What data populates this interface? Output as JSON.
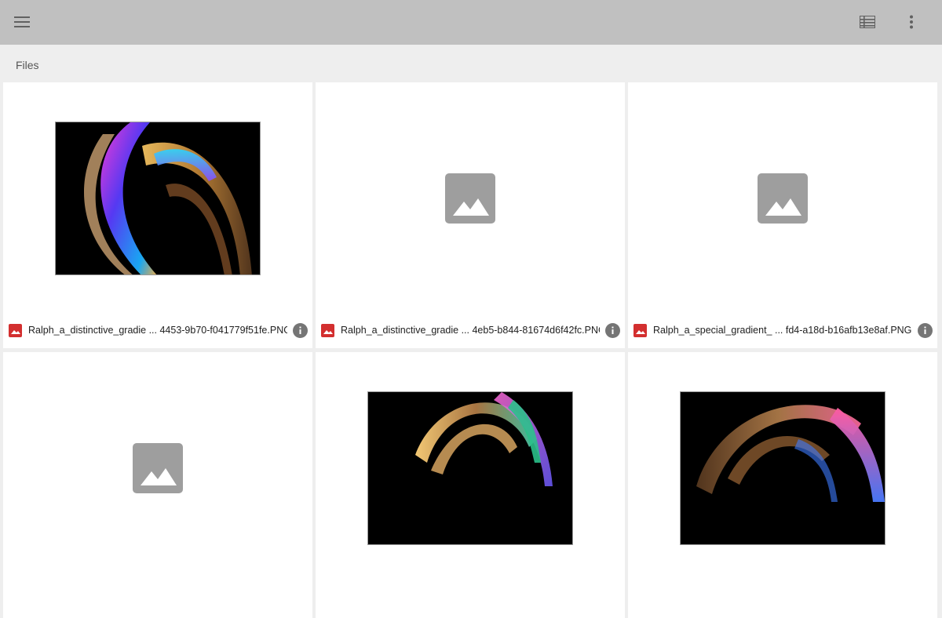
{
  "header": {
    "menu_icon": "hamburger-menu-icon",
    "view_icon": "list-view-icon",
    "more_icon": "more-vertical-icon"
  },
  "section": {
    "title": "Files"
  },
  "files": [
    {
      "name": "Ralph_a_distinctive_gradie ... 4453-9b70-f041779f51fe.PNG",
      "thumbnail": "image",
      "file_icon": "image-file-icon",
      "info_icon": "info-icon"
    },
    {
      "name": "Ralph_a_distinctive_gradie ... 4eb5-b844-81674d6f42fc.PNG",
      "thumbnail": "placeholder",
      "file_icon": "image-file-icon",
      "info_icon": "info-icon"
    },
    {
      "name": "Ralph_a_special_gradient_ ... fd4-a18d-b16afb13e8af.PNG",
      "thumbnail": "placeholder",
      "file_icon": "image-file-icon",
      "info_icon": "info-icon"
    },
    {
      "name": "",
      "thumbnail": "placeholder",
      "file_icon": "image-file-icon",
      "info_icon": "info-icon"
    },
    {
      "name": "",
      "thumbnail": "image",
      "file_icon": "image-file-icon",
      "info_icon": "info-icon"
    },
    {
      "name": "",
      "thumbnail": "image",
      "file_icon": "image-file-icon",
      "info_icon": "info-icon"
    }
  ],
  "colors": {
    "topbar": "#c0c0c0",
    "background": "#eeeeee",
    "card": "#ffffff",
    "placeholder": "#9e9e9e",
    "file_icon_red": "#d32f2f",
    "info_icon_gray": "#757575"
  }
}
